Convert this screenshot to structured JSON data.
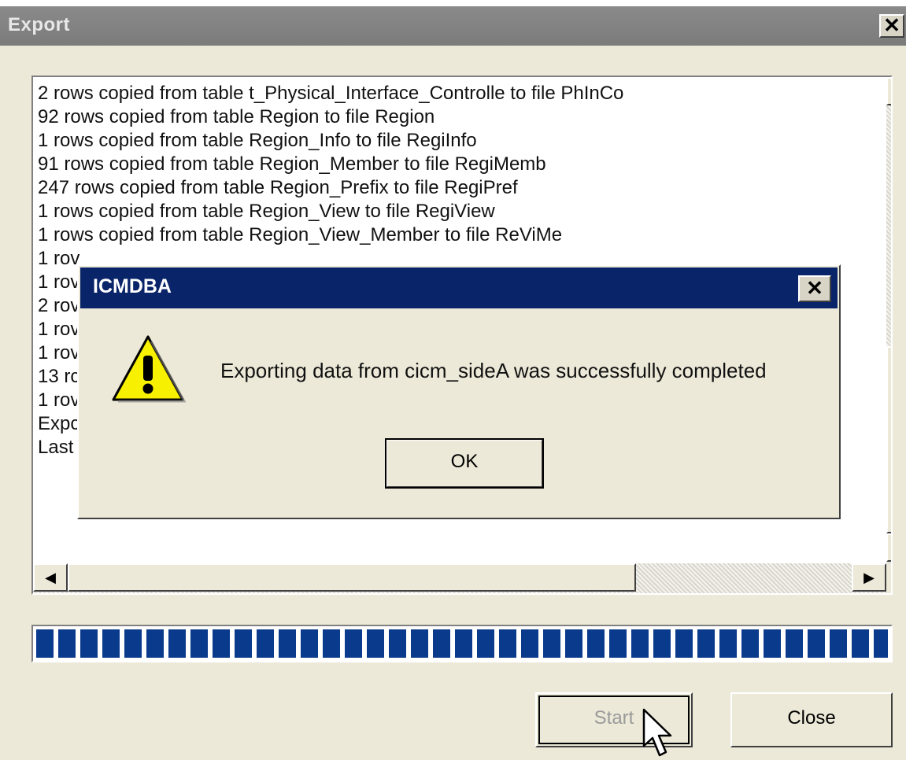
{
  "export_window": {
    "title": "Export",
    "close_glyph": "✕",
    "log_lines": [
      "2 rows copied from table t_Physical_Interface_Controlle to file PhInCo",
      "92 rows copied from table Region to file Region",
      "1 rows copied from table Region_Info to file RegiInfo",
      "91 rows copied from table Region_Member to file RegiMemb",
      "247 rows copied from table Region_Prefix to file RegiPref",
      "1 rows copied from table Region_View to file RegiView",
      "1 rows copied from table Region_View_Member to file ReViMe",
      "1 rov",
      "1 rov",
      "2 rov",
      "1 rov",
      "1 rov",
      "13 rc",
      "1 rov",
      "Expc",
      "Last"
    ],
    "progress_fraction": 1.0,
    "buttons": {
      "start_label": "Start",
      "close_label": "Close"
    }
  },
  "dialog": {
    "title": "ICMDBA",
    "close_glyph": "✕",
    "icon": "warning-icon",
    "message": "Exporting data from cicm_sideA was successfully completed",
    "ok_label": "OK"
  },
  "colors": {
    "dialog_titlebar": "#0a246a",
    "progress_fill": "#0a3a8c",
    "window_bg": "#ece9d8"
  }
}
